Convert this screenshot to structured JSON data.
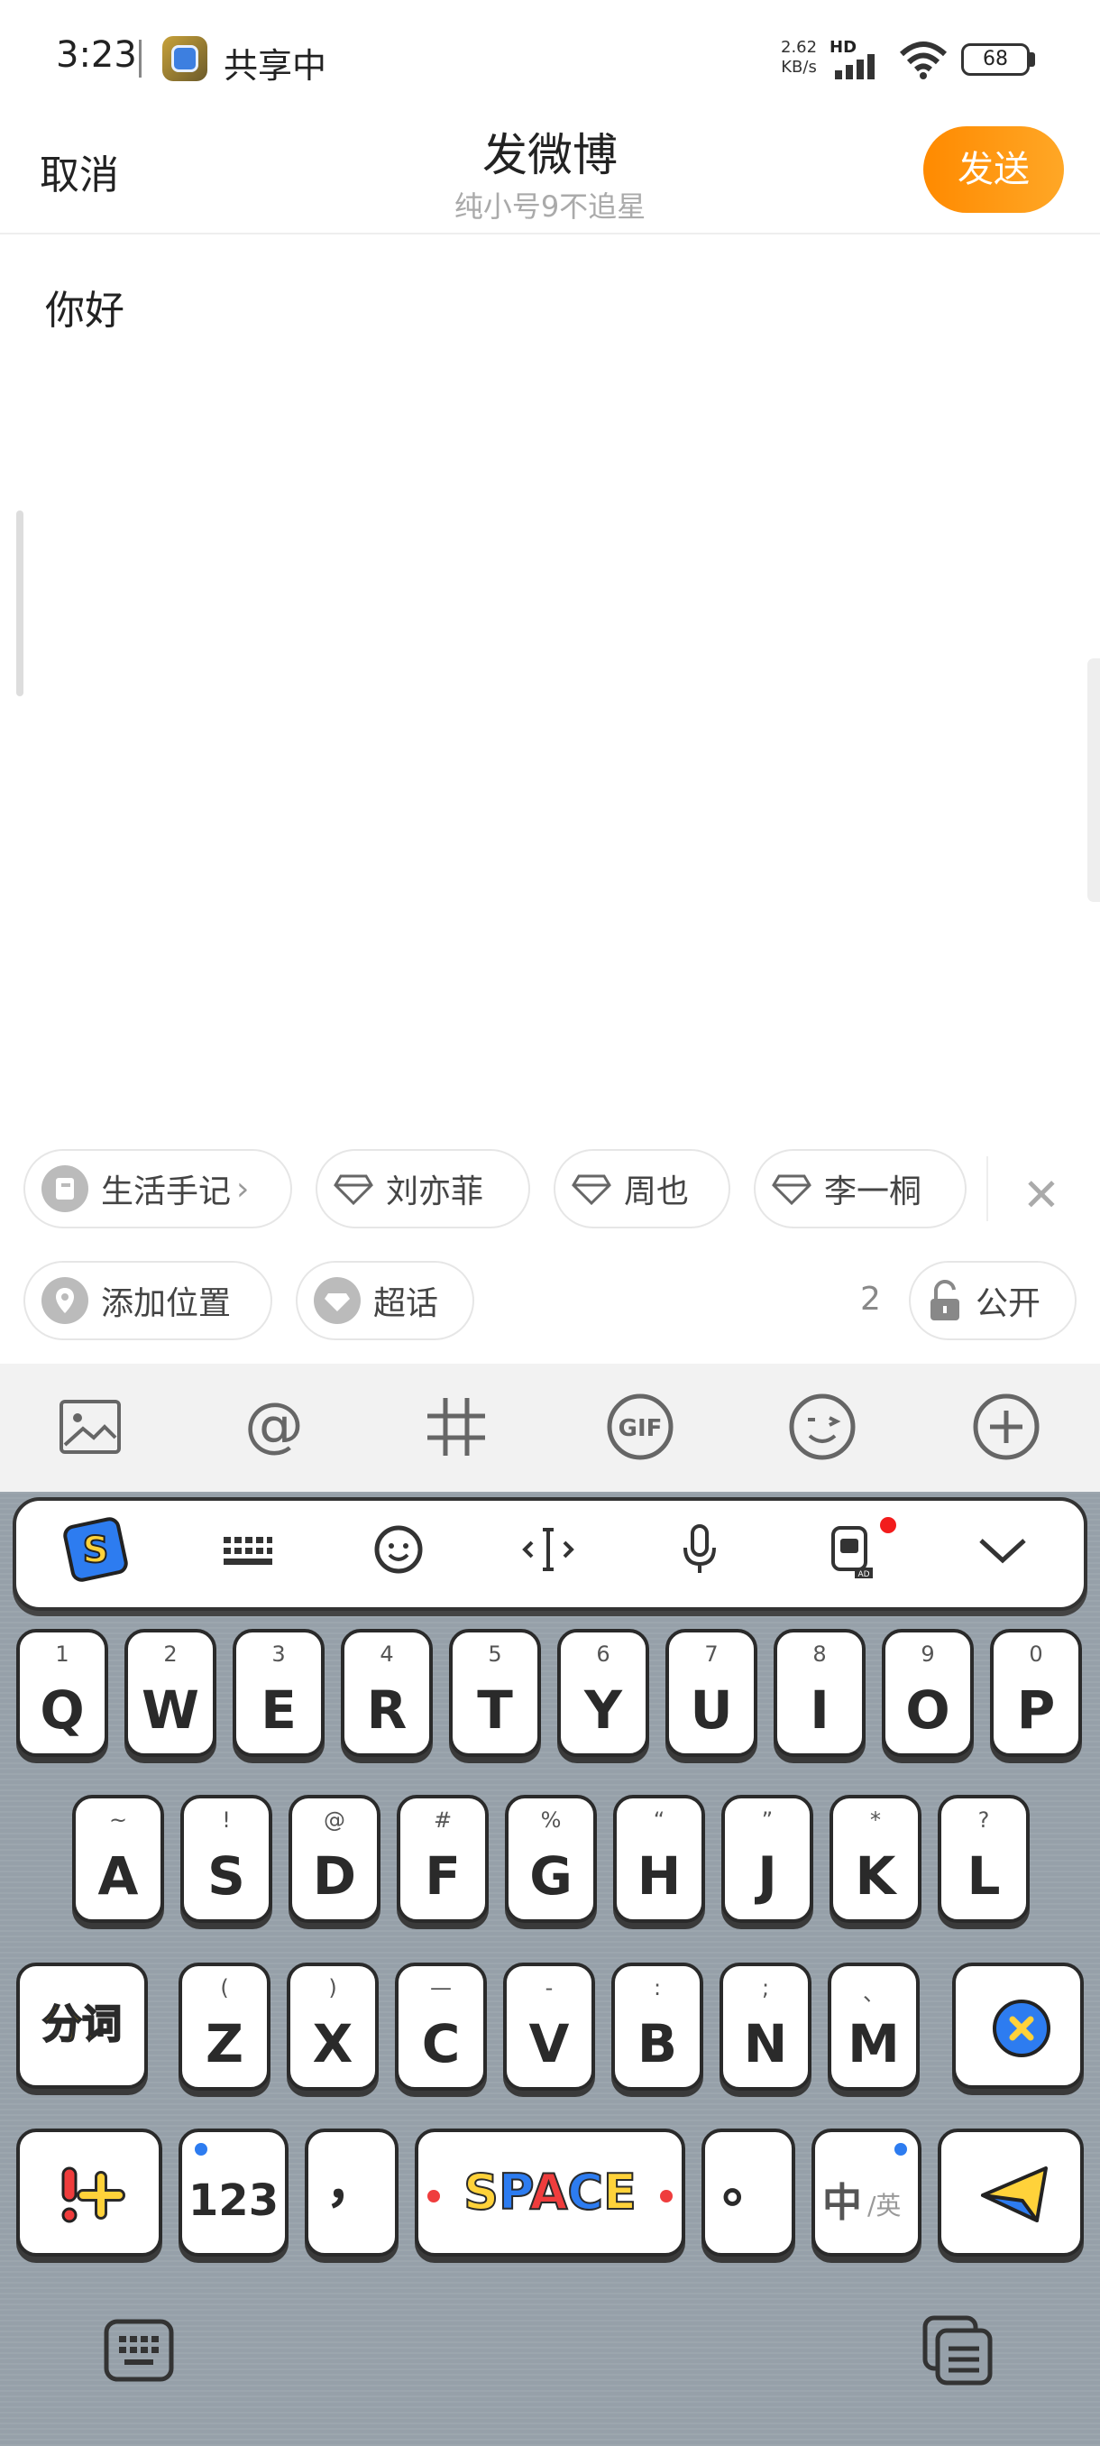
{
  "status_bar": {
    "time": "3:23",
    "sharing": "共享中",
    "net_speed_value": "2.62",
    "net_speed_unit": "KB/s",
    "hd": "HD",
    "battery": "68"
  },
  "header": {
    "cancel_label": "取消",
    "title": "发微博",
    "subtitle": "纯小号9不追星",
    "send_label": "发送"
  },
  "compose": {
    "text": "你好"
  },
  "topic_chips": [
    "生活手记",
    "刘亦菲",
    "周也",
    "李一桐"
  ],
  "options": {
    "location_label": "添加位置",
    "super_topic_label": "超话",
    "count": "2",
    "visibility_label": "公开"
  },
  "toolbar_icons": [
    "image-icon",
    "mention-icon",
    "hashtag-icon",
    "gif-icon",
    "emoji-icon",
    "plus-icon"
  ],
  "keyboard": {
    "row1": [
      {
        "main": "Q",
        "sub": "1"
      },
      {
        "main": "W",
        "sub": "2"
      },
      {
        "main": "E",
        "sub": "3"
      },
      {
        "main": "R",
        "sub": "4"
      },
      {
        "main": "T",
        "sub": "5"
      },
      {
        "main": "Y",
        "sub": "6"
      },
      {
        "main": "U",
        "sub": "7"
      },
      {
        "main": "I",
        "sub": "8"
      },
      {
        "main": "O",
        "sub": "9"
      },
      {
        "main": "P",
        "sub": "0"
      }
    ],
    "row2": [
      {
        "main": "A",
        "sub": "~"
      },
      {
        "main": "S",
        "sub": "!"
      },
      {
        "main": "D",
        "sub": "@"
      },
      {
        "main": "F",
        "sub": "#"
      },
      {
        "main": "G",
        "sub": "%"
      },
      {
        "main": "H",
        "sub": "“"
      },
      {
        "main": "J",
        "sub": "”"
      },
      {
        "main": "K",
        "sub": "*"
      },
      {
        "main": "L",
        "sub": "?"
      }
    ],
    "row3": [
      {
        "main": "Z",
        "sub": "("
      },
      {
        "main": "X",
        "sub": ")"
      },
      {
        "main": "C",
        "sub": "—"
      },
      {
        "main": "V",
        "sub": "-"
      },
      {
        "main": "B",
        "sub": ":"
      },
      {
        "main": "N",
        "sub": ";"
      },
      {
        "main": "M",
        "sub": "、"
      }
    ],
    "segment_label": "分词",
    "num_label": "123",
    "comma_label": "，",
    "space_label": "SPACE",
    "period_label": "。",
    "lang_main": "中",
    "lang_sub": "/英"
  }
}
